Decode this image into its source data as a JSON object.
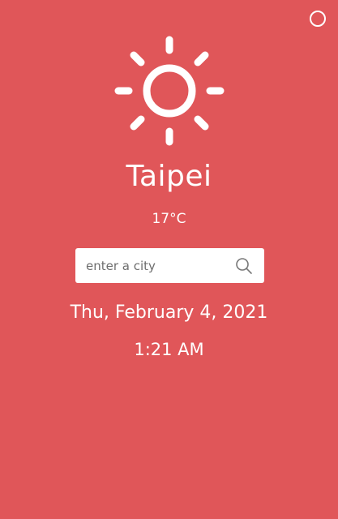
{
  "weather": {
    "icon": "sun-icon",
    "city": "Taipei",
    "temperature": "17°C"
  },
  "search": {
    "value": "",
    "placeholder": "enter a city",
    "button_icon": "search-icon"
  },
  "datetime": {
    "date": "Thu, February 4, 2021",
    "time": "1:21 AM"
  },
  "corner_control": {
    "icon": "circle-icon"
  },
  "colors": {
    "background": "#e05659",
    "foreground": "#ffffff",
    "search_background": "#ffffff",
    "placeholder": "#6e6e6e"
  }
}
